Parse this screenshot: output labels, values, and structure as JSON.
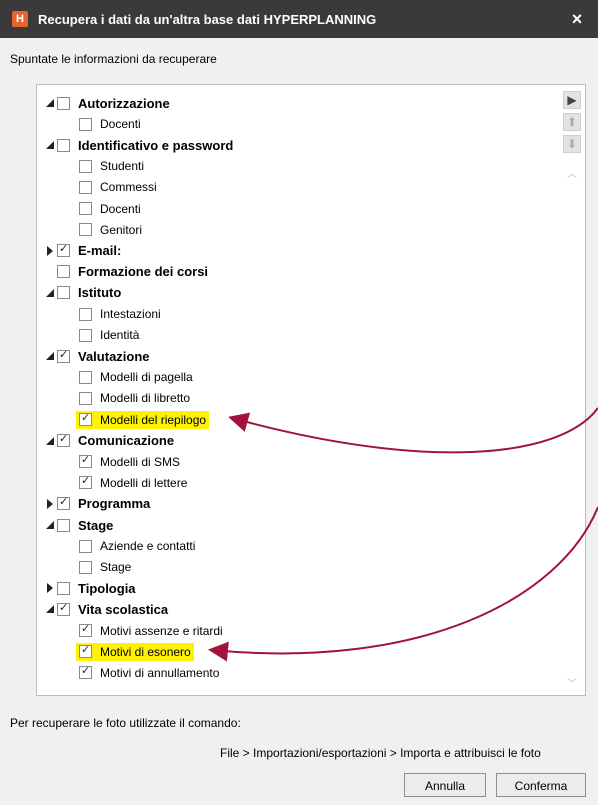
{
  "window": {
    "app_icon": "H",
    "title": "Recupera i dati da un'altra base dati HYPERPLANNING",
    "close_icon": "×"
  },
  "instruction": "Spuntate le informazioni da recuperare",
  "tree": [
    {
      "id": "autorizzazione",
      "label": "Autorizzazione",
      "level": 0,
      "toggle": "expanded",
      "checked": false,
      "bold": true
    },
    {
      "id": "docenti-1",
      "label": "Docenti",
      "level": 1,
      "toggle": "none",
      "checked": false,
      "bold": false
    },
    {
      "id": "identificativo",
      "label": "Identificativo e password",
      "level": 0,
      "toggle": "expanded",
      "checked": false,
      "bold": true
    },
    {
      "id": "studenti",
      "label": "Studenti",
      "level": 1,
      "toggle": "none",
      "checked": false,
      "bold": false
    },
    {
      "id": "commessi",
      "label": "Commessi",
      "level": 1,
      "toggle": "none",
      "checked": false,
      "bold": false
    },
    {
      "id": "docenti-2",
      "label": "Docenti",
      "level": 1,
      "toggle": "none",
      "checked": false,
      "bold": false
    },
    {
      "id": "genitori",
      "label": "Genitori",
      "level": 1,
      "toggle": "none",
      "checked": false,
      "bold": false
    },
    {
      "id": "email",
      "label": "E-mail:",
      "level": 0,
      "toggle": "collapsed",
      "checked": true,
      "bold": true
    },
    {
      "id": "formazione",
      "label": "Formazione dei corsi",
      "level": 0,
      "toggle": "none",
      "checked": false,
      "bold": true
    },
    {
      "id": "istituto",
      "label": "Istituto",
      "level": 0,
      "toggle": "expanded",
      "checked": false,
      "bold": true
    },
    {
      "id": "intestazioni",
      "label": "Intestazioni",
      "level": 1,
      "toggle": "none",
      "checked": false,
      "bold": false
    },
    {
      "id": "identita",
      "label": "Identità",
      "level": 1,
      "toggle": "none",
      "checked": false,
      "bold": false
    },
    {
      "id": "valutazione",
      "label": "Valutazione",
      "level": 0,
      "toggle": "expanded",
      "checked": true,
      "bold": true
    },
    {
      "id": "modelli-pagella",
      "label": "Modelli di pagella",
      "level": 1,
      "toggle": "none",
      "checked": false,
      "bold": false
    },
    {
      "id": "modelli-libretto",
      "label": "Modelli di libretto",
      "level": 1,
      "toggle": "none",
      "checked": false,
      "bold": false
    },
    {
      "id": "modelli-riepilogo",
      "label": "Modelli del riepilogo",
      "level": 1,
      "toggle": "none",
      "checked": true,
      "bold": false,
      "highlight": true
    },
    {
      "id": "comunicazione",
      "label": "Comunicazione",
      "level": 0,
      "toggle": "expanded",
      "checked": true,
      "bold": true
    },
    {
      "id": "modelli-sms",
      "label": "Modelli di SMS",
      "level": 1,
      "toggle": "none",
      "checked": true,
      "bold": false
    },
    {
      "id": "modelli-lettere",
      "label": "Modelli di lettere",
      "level": 1,
      "toggle": "none",
      "checked": true,
      "bold": false
    },
    {
      "id": "programma",
      "label": "Programma",
      "level": 0,
      "toggle": "collapsed",
      "checked": true,
      "bold": true
    },
    {
      "id": "stage",
      "label": "Stage",
      "level": 0,
      "toggle": "expanded",
      "checked": false,
      "bold": true
    },
    {
      "id": "aziende",
      "label": "Aziende e contatti",
      "level": 1,
      "toggle": "none",
      "checked": false,
      "bold": false
    },
    {
      "id": "stage-sub",
      "label": "Stage",
      "level": 1,
      "toggle": "none",
      "checked": false,
      "bold": false
    },
    {
      "id": "tipologia",
      "label": "Tipologia",
      "level": 0,
      "toggle": "collapsed",
      "checked": false,
      "bold": true
    },
    {
      "id": "vita-scolastica",
      "label": "Vita scolastica",
      "level": 0,
      "toggle": "expanded",
      "checked": true,
      "bold": true
    },
    {
      "id": "motivi-assenze",
      "label": "Motivi assenze e ritardi",
      "level": 1,
      "toggle": "none",
      "checked": true,
      "bold": false
    },
    {
      "id": "motivi-esonero",
      "label": "Motivi di esonero",
      "level": 1,
      "toggle": "none",
      "checked": true,
      "bold": false,
      "highlight": true
    },
    {
      "id": "motivi-annullamento",
      "label": "Motivi di annullamento",
      "level": 1,
      "toggle": "none",
      "checked": true,
      "bold": false
    }
  ],
  "scrollbar": {
    "expand_icon": "play-right-icon",
    "up_icon": "move-up-icon",
    "down_icon": "move-down-icon"
  },
  "footer": {
    "note": "Per recuperare le foto utilizzate il comando:",
    "path": "File > Importazioni/esportazioni > Importa e attribuisci le foto"
  },
  "buttons": {
    "cancel": "Annulla",
    "confirm": "Conferma"
  },
  "colors": {
    "highlight": "#fff200",
    "annotation_arrow": "#a0143c",
    "titlebar": "#3a3a3a"
  }
}
